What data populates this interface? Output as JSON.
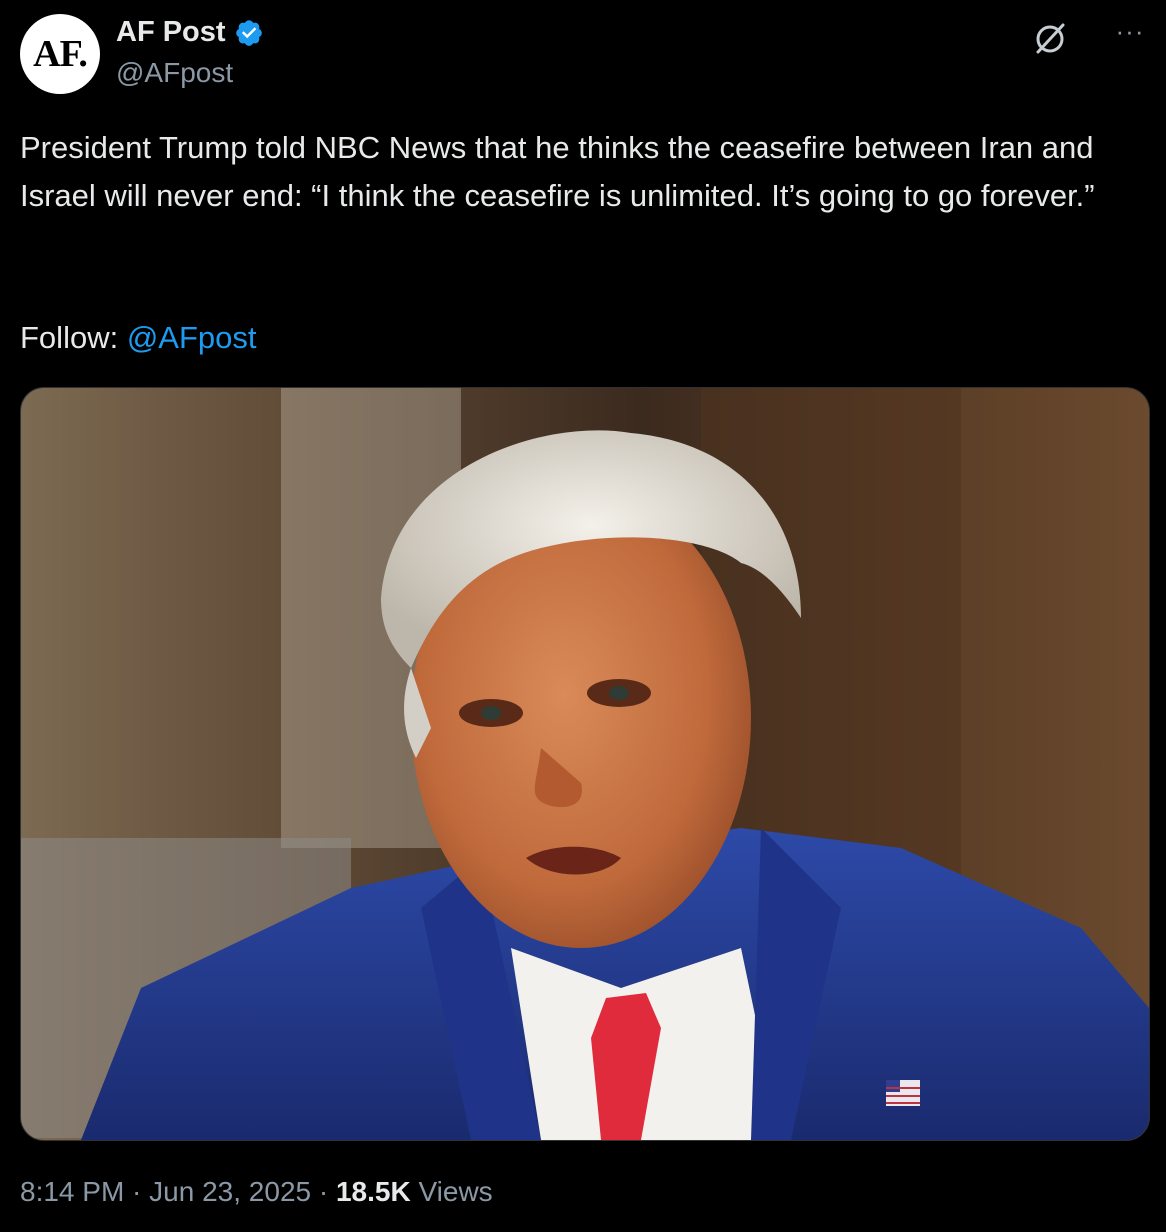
{
  "account": {
    "avatar_text": "AF.",
    "display_name": "AF Post",
    "handle": "@AFpost",
    "verified": true
  },
  "icons": {
    "verified": "verified-badge-icon",
    "grok": "grok-icon",
    "more": "more-options-icon"
  },
  "more_label": "···",
  "tweet": {
    "text": "President Trump told NBC News that he thinks the ceasefire between Iran and Israel will never end: “I think the ceasefire is unlimited. It’s going to go forever.”",
    "follow_prefix": "Follow: ",
    "follow_mention": "@AFpost"
  },
  "meta": {
    "time": "8:14 PM",
    "separator": " · ",
    "date": "Jun 23, 2025",
    "views_count": "18.5K",
    "views_label": " Views"
  },
  "colors": {
    "background": "#000000",
    "text": "#e7e9ea",
    "secondary": "#8b98a5",
    "accent": "#1d9bf0"
  }
}
